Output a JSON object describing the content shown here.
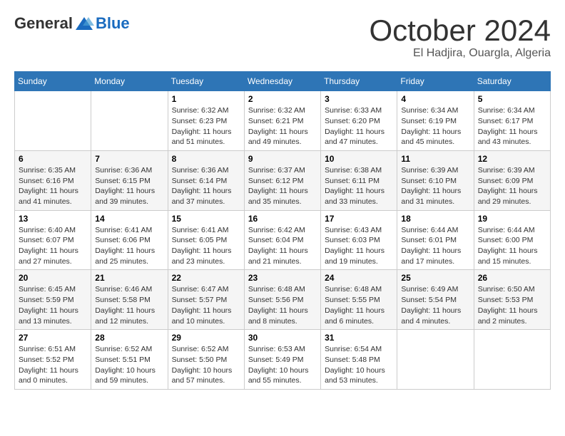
{
  "logo": {
    "general": "General",
    "blue": "Blue"
  },
  "header": {
    "month_title": "October 2024",
    "location": "El Hadjira, Ouargla, Algeria"
  },
  "days_of_week": [
    "Sunday",
    "Monday",
    "Tuesday",
    "Wednesday",
    "Thursday",
    "Friday",
    "Saturday"
  ],
  "weeks": [
    [
      {
        "day": "",
        "info": ""
      },
      {
        "day": "",
        "info": ""
      },
      {
        "day": "1",
        "info": "Sunrise: 6:32 AM\nSunset: 6:23 PM\nDaylight: 11 hours and 51 minutes."
      },
      {
        "day": "2",
        "info": "Sunrise: 6:32 AM\nSunset: 6:21 PM\nDaylight: 11 hours and 49 minutes."
      },
      {
        "day": "3",
        "info": "Sunrise: 6:33 AM\nSunset: 6:20 PM\nDaylight: 11 hours and 47 minutes."
      },
      {
        "day": "4",
        "info": "Sunrise: 6:34 AM\nSunset: 6:19 PM\nDaylight: 11 hours and 45 minutes."
      },
      {
        "day": "5",
        "info": "Sunrise: 6:34 AM\nSunset: 6:17 PM\nDaylight: 11 hours and 43 minutes."
      }
    ],
    [
      {
        "day": "6",
        "info": "Sunrise: 6:35 AM\nSunset: 6:16 PM\nDaylight: 11 hours and 41 minutes."
      },
      {
        "day": "7",
        "info": "Sunrise: 6:36 AM\nSunset: 6:15 PM\nDaylight: 11 hours and 39 minutes."
      },
      {
        "day": "8",
        "info": "Sunrise: 6:36 AM\nSunset: 6:14 PM\nDaylight: 11 hours and 37 minutes."
      },
      {
        "day": "9",
        "info": "Sunrise: 6:37 AM\nSunset: 6:12 PM\nDaylight: 11 hours and 35 minutes."
      },
      {
        "day": "10",
        "info": "Sunrise: 6:38 AM\nSunset: 6:11 PM\nDaylight: 11 hours and 33 minutes."
      },
      {
        "day": "11",
        "info": "Sunrise: 6:39 AM\nSunset: 6:10 PM\nDaylight: 11 hours and 31 minutes."
      },
      {
        "day": "12",
        "info": "Sunrise: 6:39 AM\nSunset: 6:09 PM\nDaylight: 11 hours and 29 minutes."
      }
    ],
    [
      {
        "day": "13",
        "info": "Sunrise: 6:40 AM\nSunset: 6:07 PM\nDaylight: 11 hours and 27 minutes."
      },
      {
        "day": "14",
        "info": "Sunrise: 6:41 AM\nSunset: 6:06 PM\nDaylight: 11 hours and 25 minutes."
      },
      {
        "day": "15",
        "info": "Sunrise: 6:41 AM\nSunset: 6:05 PM\nDaylight: 11 hours and 23 minutes."
      },
      {
        "day": "16",
        "info": "Sunrise: 6:42 AM\nSunset: 6:04 PM\nDaylight: 11 hours and 21 minutes."
      },
      {
        "day": "17",
        "info": "Sunrise: 6:43 AM\nSunset: 6:03 PM\nDaylight: 11 hours and 19 minutes."
      },
      {
        "day": "18",
        "info": "Sunrise: 6:44 AM\nSunset: 6:01 PM\nDaylight: 11 hours and 17 minutes."
      },
      {
        "day": "19",
        "info": "Sunrise: 6:44 AM\nSunset: 6:00 PM\nDaylight: 11 hours and 15 minutes."
      }
    ],
    [
      {
        "day": "20",
        "info": "Sunrise: 6:45 AM\nSunset: 5:59 PM\nDaylight: 11 hours and 13 minutes."
      },
      {
        "day": "21",
        "info": "Sunrise: 6:46 AM\nSunset: 5:58 PM\nDaylight: 11 hours and 12 minutes."
      },
      {
        "day": "22",
        "info": "Sunrise: 6:47 AM\nSunset: 5:57 PM\nDaylight: 11 hours and 10 minutes."
      },
      {
        "day": "23",
        "info": "Sunrise: 6:48 AM\nSunset: 5:56 PM\nDaylight: 11 hours and 8 minutes."
      },
      {
        "day": "24",
        "info": "Sunrise: 6:48 AM\nSunset: 5:55 PM\nDaylight: 11 hours and 6 minutes."
      },
      {
        "day": "25",
        "info": "Sunrise: 6:49 AM\nSunset: 5:54 PM\nDaylight: 11 hours and 4 minutes."
      },
      {
        "day": "26",
        "info": "Sunrise: 6:50 AM\nSunset: 5:53 PM\nDaylight: 11 hours and 2 minutes."
      }
    ],
    [
      {
        "day": "27",
        "info": "Sunrise: 6:51 AM\nSunset: 5:52 PM\nDaylight: 11 hours and 0 minutes."
      },
      {
        "day": "28",
        "info": "Sunrise: 6:52 AM\nSunset: 5:51 PM\nDaylight: 10 hours and 59 minutes."
      },
      {
        "day": "29",
        "info": "Sunrise: 6:52 AM\nSunset: 5:50 PM\nDaylight: 10 hours and 57 minutes."
      },
      {
        "day": "30",
        "info": "Sunrise: 6:53 AM\nSunset: 5:49 PM\nDaylight: 10 hours and 55 minutes."
      },
      {
        "day": "31",
        "info": "Sunrise: 6:54 AM\nSunset: 5:48 PM\nDaylight: 10 hours and 53 minutes."
      },
      {
        "day": "",
        "info": ""
      },
      {
        "day": "",
        "info": ""
      }
    ]
  ]
}
